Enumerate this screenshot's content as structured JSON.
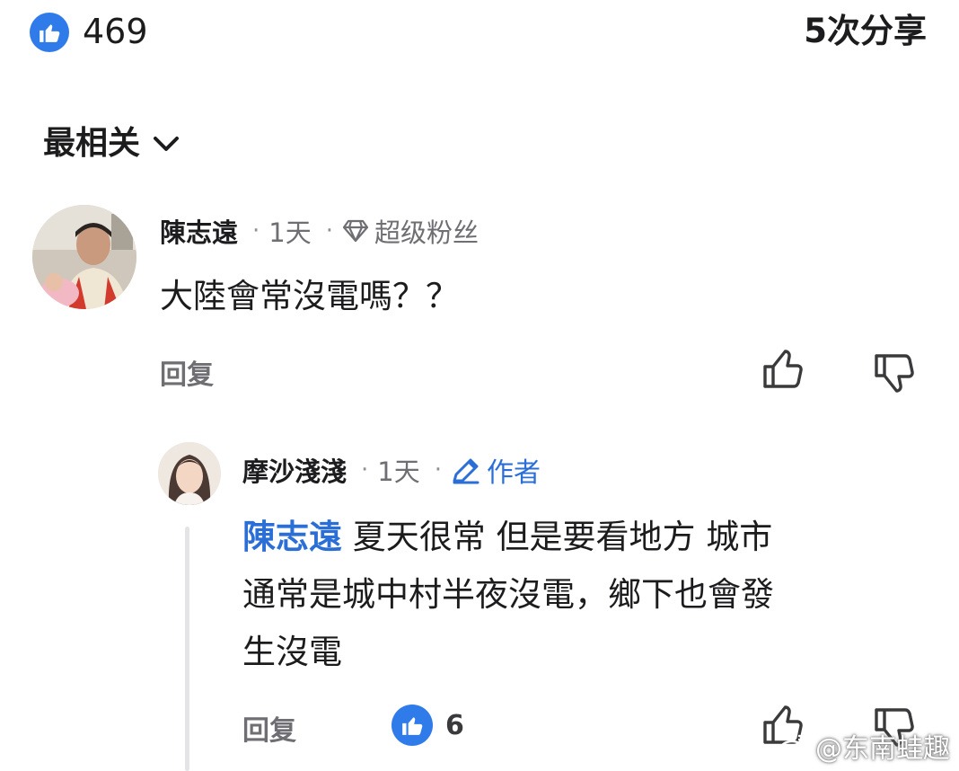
{
  "summary": {
    "like_count": "469",
    "share_text": "5次分享"
  },
  "sort": {
    "label": "最相关"
  },
  "comments": [
    {
      "author": "陳志遠",
      "time": "1天",
      "badge": "超级粉丝",
      "text": "大陸會常沒電嗎？？",
      "reply_label": "回复"
    }
  ],
  "replies": [
    {
      "author": "摩沙淺淺",
      "time": "1天",
      "badge": "作者",
      "mention": "陳志遠",
      "line1": " 夏天很常 但是要看地方 城市",
      "line2": "通常是城中村半夜沒電，鄉下也會發",
      "line3": "生沒電",
      "reply_label": "回复",
      "like_count": "6"
    }
  ],
  "watermark": {
    "text": "@东南蛙趣"
  },
  "colors": {
    "accent_blue": "#2f7bea",
    "mention_blue": "#2b6fd6",
    "text_primary": "#1c1c1e",
    "text_secondary": "#6e6e73"
  }
}
